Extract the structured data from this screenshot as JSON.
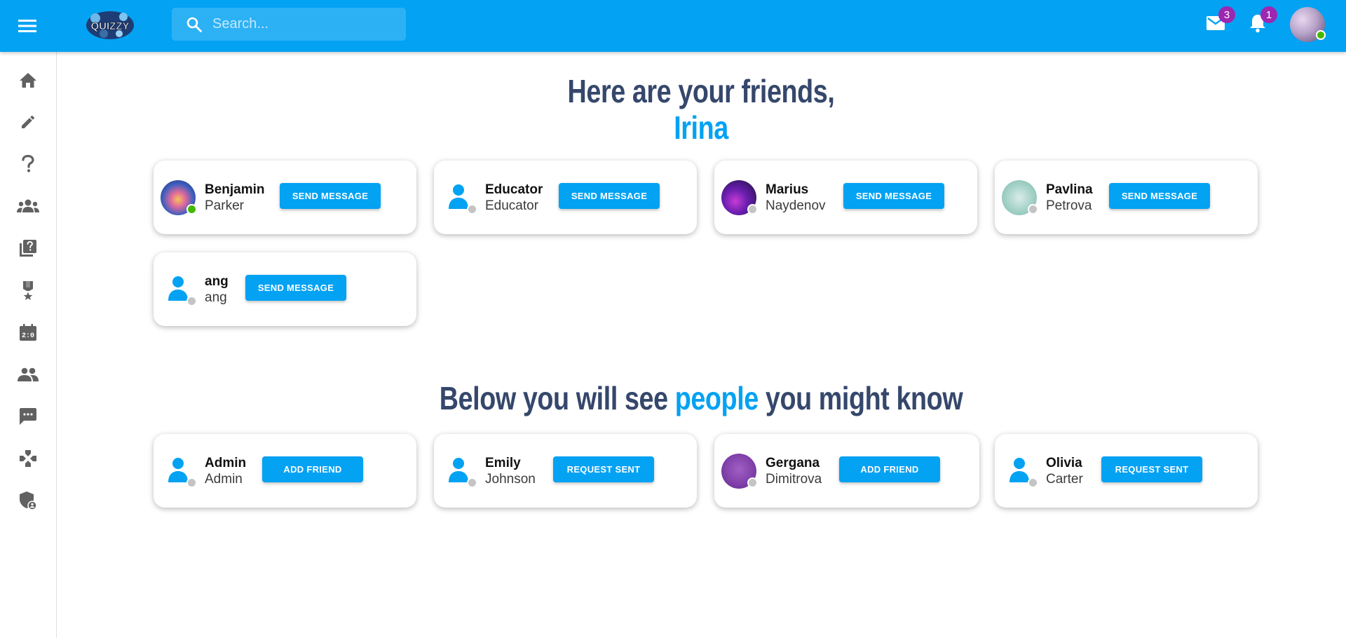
{
  "header": {
    "logo_text": "QUIZZY",
    "search_placeholder": "Search...",
    "mail_count": "3",
    "notifications_count": "1"
  },
  "sidebar": {
    "items": [
      {
        "icon": "home-icon"
      },
      {
        "icon": "pencil-icon"
      },
      {
        "icon": "question-icon"
      },
      {
        "icon": "groups-icon"
      },
      {
        "icon": "quiz-icon"
      },
      {
        "icon": "medal-icon"
      },
      {
        "icon": "scoreboard-icon"
      },
      {
        "icon": "people-icon"
      },
      {
        "icon": "chat-icon"
      },
      {
        "icon": "gamepad-icon"
      },
      {
        "icon": "admin-shield-icon"
      }
    ]
  },
  "friends_section": {
    "title_line1": "Here are your friends,",
    "title_name": "Irina",
    "friends": [
      {
        "first": "Benjamin",
        "last": "Parker",
        "button": "SEND MESSAGE",
        "online": true
      },
      {
        "first": "Educator",
        "last": "Educator",
        "button": "SEND MESSAGE",
        "online": false
      },
      {
        "first": "Marius",
        "last": "Naydenov",
        "button": "SEND MESSAGE",
        "online": false
      },
      {
        "first": "Pavlina",
        "last": "Petrova",
        "button": "SEND MESSAGE",
        "online": false
      },
      {
        "first": "ang",
        "last": "ang",
        "button": "SEND MESSAGE",
        "online": false
      }
    ]
  },
  "suggestions_section": {
    "title_before": "Below you will see",
    "title_accent": "people",
    "title_after": "you might know",
    "people": [
      {
        "first": "Admin",
        "last": "Admin",
        "button": "ADD FRIEND"
      },
      {
        "first": "Emily",
        "last": "Johnson",
        "button": "REQUEST SENT"
      },
      {
        "first": "Gergana",
        "last": "Dimitrova",
        "button": "ADD FRIEND"
      },
      {
        "first": "Olivia",
        "last": "Carter",
        "button": "REQUEST SENT"
      }
    ]
  },
  "colors": {
    "primary": "#03a2f3",
    "heading": "#35476b",
    "badge": "#9c27b0",
    "online": "#44b700"
  }
}
